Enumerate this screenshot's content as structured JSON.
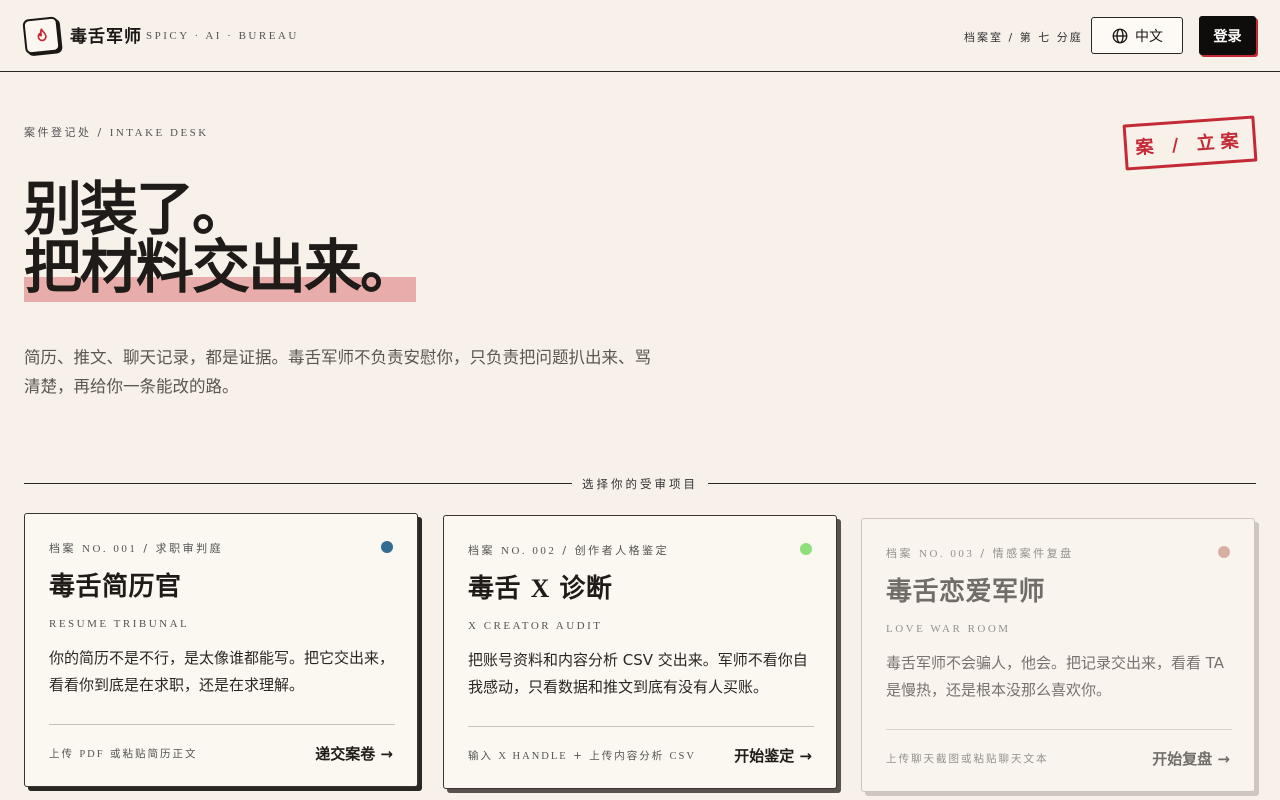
{
  "header": {
    "brand": "毒舌军师",
    "brand_sub": "SPICY · AI · BUREAU",
    "crumb": "档案室 / 第 七 分庭",
    "lang_label": "中文",
    "login_label": "登录",
    "logo_icon": "flame-icon",
    "lang_icon": "globe-icon"
  },
  "hero": {
    "intake_cn": "案件登记处 / ",
    "intake_en": "INTAKE DESK",
    "stamp": "案 / 立案",
    "title_line1": "别装了。",
    "title_line2": "把材料交出来。",
    "description": "简历、推文、聊天记录，都是证据。毒舌军师不负责安慰你，只负责把问题扒出来、骂清楚，再给你一条能改的路。",
    "highlight_color": "#e8adab"
  },
  "divider": {
    "label": "选择你的受审项目"
  },
  "cards": [
    {
      "no_cn": "档案 ",
      "no_en": "NO. 001",
      "no_tail": " / 求职审判庭",
      "title": "毒舌简历官",
      "subtitle": "RESUME TRIBUNAL",
      "body": "你的简历不是不行，是太像谁都能写。把它交出来，看看你到底是在求职，还是在求理解。",
      "hint_cn": "上传 ",
      "hint_en": "PDF",
      "hint_tail": " 或粘贴简历正文",
      "cta": "递交案卷 →",
      "dot_color": "#336b94"
    },
    {
      "no_cn": "档案 ",
      "no_en": "NO. 002",
      "no_tail": " / 创作者人格鉴定",
      "title_a": "毒舌 ",
      "title_b": "X",
      "title_c": " 诊断",
      "subtitle": "X CREATOR AUDIT",
      "body": "把账号资料和内容分析 CSV 交出来。军师不看你自我感动，只看数据和推文到底有没有人买账。",
      "hint_cn": "输入 ",
      "hint_en": "X HANDLE",
      "hint_mid": " + 上传内容分析 ",
      "hint_en2": "CSV",
      "cta": "开始鉴定 →",
      "dot_color": "#8fe07a"
    },
    {
      "no_cn": "档案 ",
      "no_en": "NO. 003",
      "no_tail": " / 情感案件复盘",
      "title": "毒舌恋爱军师",
      "subtitle": "LOVE WAR ROOM",
      "body": "毒舌军师不会骗人，他会。把记录交出来，看看 TA 是慢热，还是根本没那么喜欢你。",
      "hint": "上传聊天截图或粘贴聊天文本",
      "cta": "开始复盘 →",
      "dot_color": "#c7877a"
    }
  ]
}
